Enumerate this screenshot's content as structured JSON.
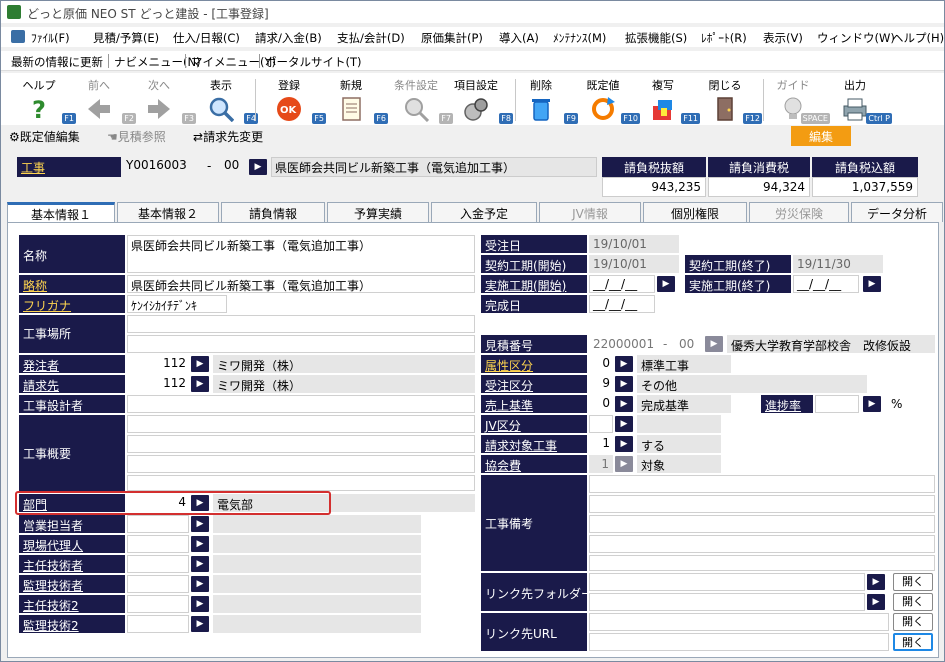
{
  "window": {
    "title": "どっと原価 NEO ST どっと建設 - [工事登録]"
  },
  "menu": [
    "ﾌｧｲﾙ(F)",
    "見積/予算(E)",
    "仕入/日報(C)",
    "請求/入金(B)",
    "支払/会計(D)",
    "原価集計(P)",
    "導入(A)",
    "ﾒﾝﾃﾅﾝｽ(M)",
    "拡張機能(S)",
    "ﾚﾎﾟｰﾄ(R)",
    "表示(V)",
    "ウィンドウ(W)",
    "ヘルプ(H)"
  ],
  "linkbar": [
    "最新の情報に更新",
    "ナビメニュー(N)",
    "マイメニュー(Y)",
    "ポータルサイト(T)"
  ],
  "toolbar": [
    {
      "label": "ヘルプ",
      "fkey": "F1",
      "icon": "help-icon"
    },
    {
      "label": "前へ",
      "fkey": "F2",
      "icon": "arrow-left-icon"
    },
    {
      "label": "次へ",
      "fkey": "F3",
      "icon": "arrow-right-icon"
    },
    {
      "label": "表示",
      "fkey": "F4",
      "icon": "magnifier-icon"
    },
    {
      "label": "登録",
      "fkey": "F5",
      "icon": "ok-icon"
    },
    {
      "label": "新規",
      "fkey": "F6",
      "icon": "new-document-icon"
    },
    {
      "label": "条件設定",
      "fkey": "F7",
      "icon": "condition-icon"
    },
    {
      "label": "項目設定",
      "fkey": "F8",
      "icon": "item-settings-icon"
    },
    {
      "label": "削除",
      "fkey": "F9",
      "icon": "trash-icon"
    },
    {
      "label": "既定値",
      "fkey": "F10",
      "icon": "refresh-icon"
    },
    {
      "label": "複写",
      "fkey": "F11",
      "icon": "copy-icon"
    },
    {
      "label": "閉じる",
      "fkey": "F12",
      "icon": "door-icon"
    },
    {
      "label": "ガイド",
      "fkey": "SPACE",
      "icon": "bulb-icon"
    },
    {
      "label": "出力",
      "fkey": "Ctrl P",
      "icon": "print-icon"
    }
  ],
  "subbar": {
    "default_edit": "既定値編集",
    "estimate_ref": "見積参照",
    "billing_change": "請求先変更",
    "edit": "編集"
  },
  "header": {
    "label": "工事",
    "code": "Y0016003",
    "dash": "-",
    "branch": "00",
    "name": "県医師会共同ビル新築工事（電気追加工事）",
    "totals": [
      {
        "head": "請負税抜額",
        "value": "943,235"
      },
      {
        "head": "請負消費税",
        "value": "94,324"
      },
      {
        "head": "請負税込額",
        "value": "1,037,559"
      }
    ]
  },
  "tabs": [
    "基本情報１",
    "基本情報２",
    "請負情報",
    "予算実績",
    "入金予定",
    "JV情報",
    "個別権限",
    "労災保険",
    "データ分析"
  ],
  "left": {
    "name_label": "名称",
    "name": "県医師会共同ビル新築工事（電気追加工事）",
    "short_label": "略称",
    "short": "県医師会共同ビル新築工事（電気追加工事）",
    "kana_label": "フリガナ",
    "kana": "ｹﾝｲｼｶｲﾁﾃﾞﾝｷ",
    "site_label": "工事場所",
    "orderer_label": "発注者",
    "orderer_code": "112",
    "orderer_name": "ミワ開発（株）",
    "billing_label": "請求先",
    "billing_code": "112",
    "billing_name": "ミワ開発（株）",
    "designer_label": "工事設計者",
    "summary_label": "工事概要",
    "dept_label": "部門",
    "dept_code": "4",
    "dept_name": "電気部",
    "sales_label": "営業担当者",
    "site_agent_label": "現場代理人",
    "chief_label": "主任技術者",
    "supervisor_label": "監理技術者",
    "chief2_label": "主任技術2",
    "supervisor2_label": "監理技術2"
  },
  "right": {
    "order_date_label": "受注日",
    "order_date": "19/10/01",
    "contract_start_label": "契約工期(開始)",
    "contract_start": "19/10/01",
    "contract_end_label": "契約工期(終了)",
    "contract_end": "19/11/30",
    "actual_start_label": "実施工期(開始)",
    "actual_start": "__/__/__",
    "actual_end_label": "実施工期(終了)",
    "actual_end": "__/__/__",
    "complete_label": "完成日",
    "complete": "__/__/__",
    "estimate_label": "見積番号",
    "estimate_code": "22000001",
    "estimate_branch": "00",
    "estimate_name": "優秀大学教育学部校舎　改修仮設",
    "attr_label": "属性区分",
    "attr_code": "0",
    "attr_name": "標準工事",
    "order_type_label": "受注区分",
    "order_type_code": "9",
    "order_type_name": "その他",
    "sales_std_label": "売上基準",
    "sales_std_code": "0",
    "sales_std_name": "完成基準",
    "progress_label": "進捗率",
    "percent": "%",
    "jv_label": "JV区分",
    "billing_target_label": "請求対象工事",
    "billing_target_code": "1",
    "billing_target_name": "する",
    "assoc_fee_label": "協会費",
    "assoc_fee_code": "1",
    "assoc_fee_name": "対象",
    "remarks_label": "工事備考",
    "link_folder_label": "リンク先フォルダー",
    "link_url_label": "リンク先URL",
    "open_label": "開く"
  }
}
